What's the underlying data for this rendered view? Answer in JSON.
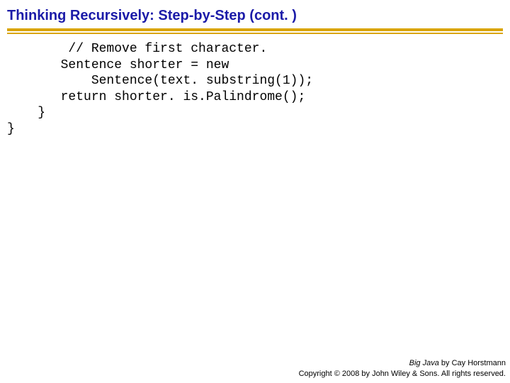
{
  "title": "Thinking Recursively: Step-by-Step  (cont. )",
  "code": {
    "l1": "        // Remove first character.",
    "l2": "       Sentence shorter = new",
    "l3": "           Sentence(text. substring(1));",
    "l4": "       return shorter. is.Palindrome();",
    "l5": "    }",
    "l6": "}"
  },
  "footer": {
    "book": "Big Java",
    "byline": " by Cay Horstmann",
    "copyright": "Copyright © 2008 by John Wiley & Sons.  All rights reserved."
  }
}
